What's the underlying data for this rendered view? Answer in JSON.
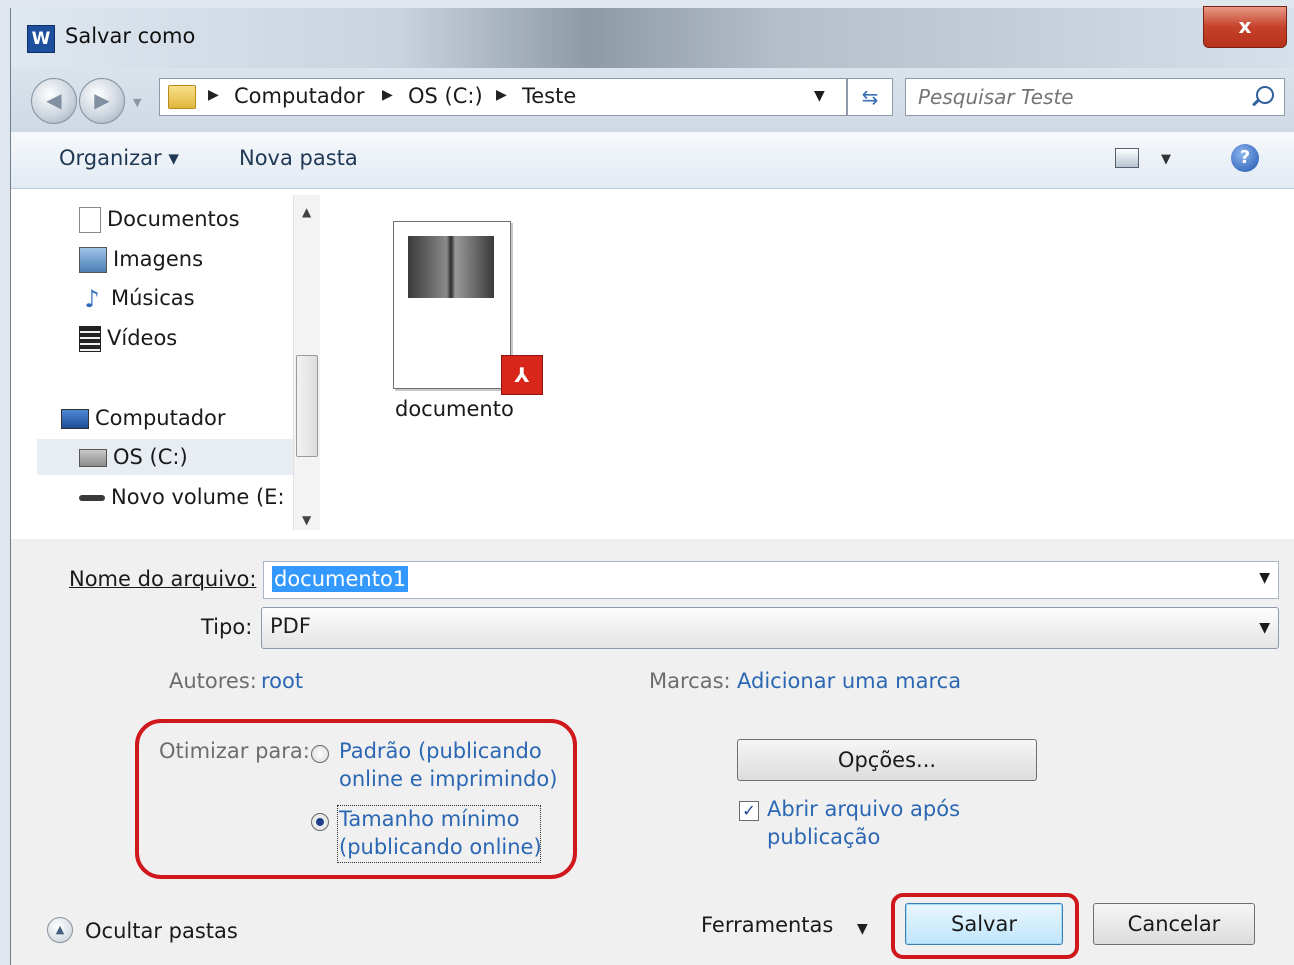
{
  "window": {
    "title": "Salvar como",
    "app_icon_letter": "W",
    "close_glyph": "x"
  },
  "navigation": {
    "breadcrumbs": [
      "Computador",
      "OS (C:)",
      "Teste"
    ],
    "search_placeholder": "Pesquisar Teste"
  },
  "toolbar": {
    "organize_label": "Organizar ▾",
    "new_folder_label": "Nova pasta",
    "help_glyph": "?"
  },
  "nav_tree": {
    "items": [
      {
        "label": "Documentos",
        "icon": "documents-icon"
      },
      {
        "label": "Imagens",
        "icon": "pictures-icon"
      },
      {
        "label": "Músicas",
        "icon": "music-icon"
      },
      {
        "label": "Vídeos",
        "icon": "videos-icon"
      },
      {
        "label": "Computador",
        "icon": "computer-icon"
      },
      {
        "label": "OS (C:)",
        "icon": "drive-icon",
        "selected": true
      },
      {
        "label": "Novo volume (E:",
        "icon": "external-drive-icon"
      }
    ]
  },
  "files": [
    {
      "name": "documento",
      "type_badge": "pdf-icon"
    }
  ],
  "form": {
    "filename_label": "Nome do arquivo:",
    "filename_value": "documento1",
    "type_label": "Tipo:",
    "type_value": "PDF",
    "authors_label": "Autores:",
    "authors_value": "root",
    "tags_label": "Marcas:",
    "tags_value": "Adicionar uma marca",
    "optimize_label": "Otimizar para:",
    "optimize_options": [
      {
        "line1": "Padrão (publicando",
        "line2": "online e imprimindo)",
        "selected": false
      },
      {
        "line1": "Tamanho mínimo",
        "line2": "(publicando online)",
        "selected": true
      }
    ],
    "options_button": "Opções...",
    "open_after_line1": "Abrir arquivo após",
    "open_after_line2": "publicação",
    "open_after_checked": true
  },
  "footer": {
    "hide_folders_label": "Ocultar pastas",
    "tools_label": "Ferramentas",
    "save_button": "Salvar",
    "cancel_button": "Cancelar"
  },
  "colors": {
    "highlight_annotation": "#d0171b",
    "link": "#2b67b3",
    "selection": "#3399ff"
  }
}
